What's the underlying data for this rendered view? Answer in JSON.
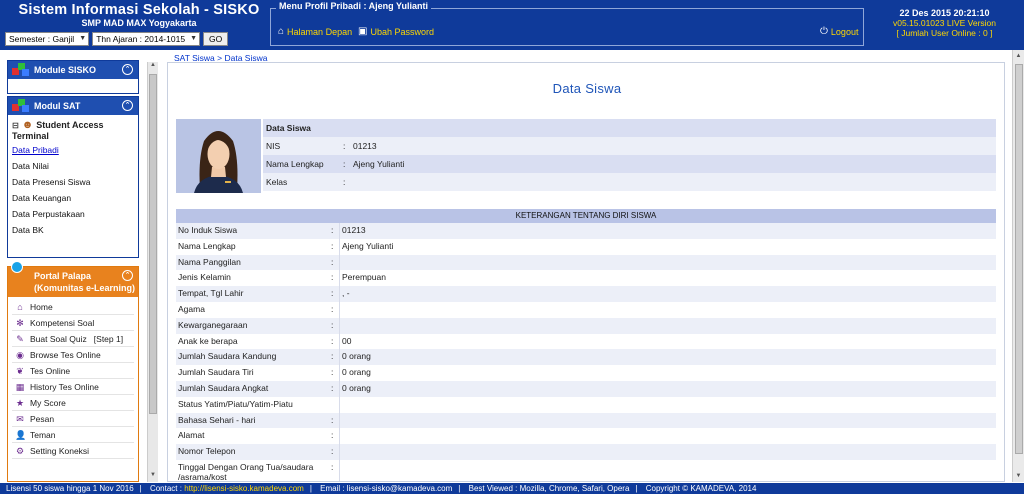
{
  "header": {
    "app_title": "Sistem Informasi Sekolah - SISKO",
    "school": "SMP MAD MAX Yogyakarta",
    "semester_select": "Semester : Ganjil",
    "year_select": "Thn Ajaran : 2014-1015",
    "go_label": "GO",
    "profile_menu_title": "Menu Profil Pribadi : Ajeng Yulianti",
    "home_link": "Halaman Depan",
    "password_link": "Ubah Password",
    "logout_label": "Logout",
    "datetime": "22 Des 2015 20:21:10",
    "version": "v05.15.01023 LIVE Version",
    "online": "[ Jumlah User Online : 0 ]"
  },
  "sidebar": {
    "module_sisko": "Module SISKO",
    "modul_sat": "Modul SAT",
    "tree_head": "Student Access",
    "tree_sub": "Terminal",
    "sat_items": [
      "Data Pribadi",
      "Data Nilai",
      "Data Presensi Siswa",
      "Data Keuangan",
      "Data Perpustakaan",
      "Data BK"
    ],
    "portal_title_1": "Portal Palapa",
    "portal_title_2": "(Komunitas e-Learning)",
    "portal_items": [
      {
        "label": "Home",
        "icon": "home-icon"
      },
      {
        "label": "Kompetensi Soal",
        "icon": "gear-icon"
      },
      {
        "label": "Buat Soal Quiz   [Step 1]",
        "icon": "edit-icon"
      },
      {
        "label": "Browse Tes Online",
        "icon": "eye-icon"
      },
      {
        "label": "Tes Online",
        "icon": "leaf-icon"
      },
      {
        "label": "History Tes Online",
        "icon": "calendar-icon"
      },
      {
        "label": "My Score",
        "icon": "star-icon"
      },
      {
        "label": "Pesan",
        "icon": "mail-icon"
      },
      {
        "label": "Teman",
        "icon": "person-icon"
      },
      {
        "label": "Setting Koneksi",
        "icon": "settings-icon"
      }
    ]
  },
  "main": {
    "breadcrumb": "SAT Siswa > Data Siswa",
    "title": "Data Siswa",
    "card": {
      "header": "Data Siswa",
      "rows": [
        {
          "label": "NIS",
          "colon": ":",
          "value": "01213"
        },
        {
          "label": "Nama Lengkap",
          "colon": ":",
          "value": "Ajeng Yulianti"
        },
        {
          "label": "Kelas",
          "colon": ":",
          "value": ""
        }
      ]
    },
    "section_header": "KETERANGAN TENTANG DIRI SISWA",
    "details": [
      {
        "label": "No Induk Siswa",
        "colon": ":",
        "value": "01213"
      },
      {
        "label": "Nama Lengkap",
        "colon": ":",
        "value": "Ajeng Yulianti"
      },
      {
        "label": "Nama Panggilan",
        "colon": ":",
        "value": ""
      },
      {
        "label": "Jenis Kelamin",
        "colon": ":",
        "value": "Perempuan"
      },
      {
        "label": "Tempat, Tgl Lahir",
        "colon": ":",
        "value": ", -"
      },
      {
        "label": "Agama",
        "colon": ":",
        "value": ""
      },
      {
        "label": "Kewarganegaraan",
        "colon": ":",
        "value": ""
      },
      {
        "label": "Anak ke berapa",
        "colon": ":",
        "value": "00"
      },
      {
        "label": "Jumlah Saudara Kandung",
        "colon": ":",
        "value": "0 orang"
      },
      {
        "label": "Jumlah Saudara Tiri",
        "colon": ":",
        "value": "0 orang"
      },
      {
        "label": "Jumlah Saudara Angkat",
        "colon": ":",
        "value": "0 orang"
      },
      {
        "label": "Status Yatim/Piatu/Yatim-Piatu",
        "colon": "",
        "value": ""
      },
      {
        "label": "Bahasa Sehari - hari",
        "colon": ":",
        "value": ""
      },
      {
        "label": "Alamat",
        "colon": ":",
        "value": ""
      },
      {
        "label": "Nomor Telepon",
        "colon": ":",
        "value": ""
      },
      {
        "label": "Tinggal Dengan Orang Tua/saudara /asrama/kost",
        "colon": ":",
        "value": ""
      }
    ]
  },
  "footer": {
    "license": "Lisensi 50 siswa hingga 1 Nov 2016",
    "contact_label": "Contact :",
    "contact_url": "http://lisensi-sisko.kamadeva.com",
    "email": "Email : lisensi-sisko@kamadeva.com",
    "best_viewed": "Best Viewed : Mozilla, Chrome, Safari, Opera",
    "copyright": "Copyright © KAMADEVA, 2014"
  }
}
